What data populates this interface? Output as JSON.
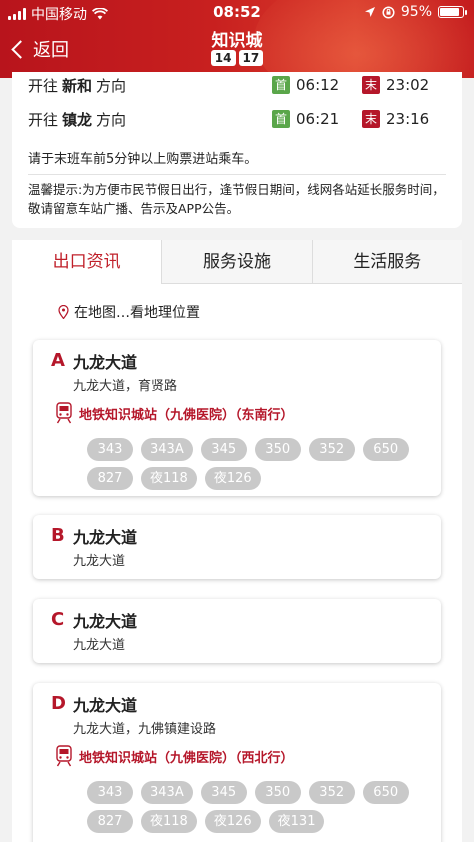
{
  "status_bar": {
    "carrier": "中国移动",
    "time": "08:52",
    "battery": "95%",
    "battery_level": 0.95
  },
  "nav": {
    "back_label": "返回",
    "title": "知识城",
    "lines": [
      "14",
      "17"
    ]
  },
  "directions": [
    {
      "prefix": "开往",
      "dest": "新和",
      "suffix": "方向",
      "first_label": "首",
      "first_time": "06:12",
      "last_label": "末",
      "last_time": "23:02"
    },
    {
      "prefix": "开往",
      "dest": "镇龙",
      "suffix": "方向",
      "first_label": "首",
      "first_time": "06:21",
      "last_label": "末",
      "last_time": "23:16"
    }
  ],
  "notice": "请于末班车前5分钟以上购票进站乘车。",
  "tip": "温馨提示:为方便市民节假日出行，逢节假日期间，线网各站延长服务时间，敬请留意车站广播、告示及APP公告。",
  "tabs": [
    "出口资讯",
    "服务设施",
    "生活服务"
  ],
  "map_link": "在地图…看地理位置",
  "exits": [
    {
      "letter": "A",
      "road": "九龙大道",
      "street": "九龙大道，育贤路",
      "metro": "地铁知识城站（九佛医院）（东南行）",
      "buses": [
        "343",
        "343A",
        "345",
        "350",
        "352",
        "650",
        "827",
        "夜118",
        "夜126"
      ]
    },
    {
      "letter": "B",
      "road": "九龙大道",
      "street": "九龙大道"
    },
    {
      "letter": "C",
      "road": "九龙大道",
      "street": "九龙大道"
    },
    {
      "letter": "D",
      "road": "九龙大道",
      "street": "九龙大道，九佛镇建设路",
      "metro": "地铁知识城站（九佛医院）（西北行）",
      "buses": [
        "343",
        "343A",
        "345",
        "350",
        "352",
        "650",
        "827",
        "夜118",
        "夜126",
        "夜131"
      ]
    }
  ]
}
